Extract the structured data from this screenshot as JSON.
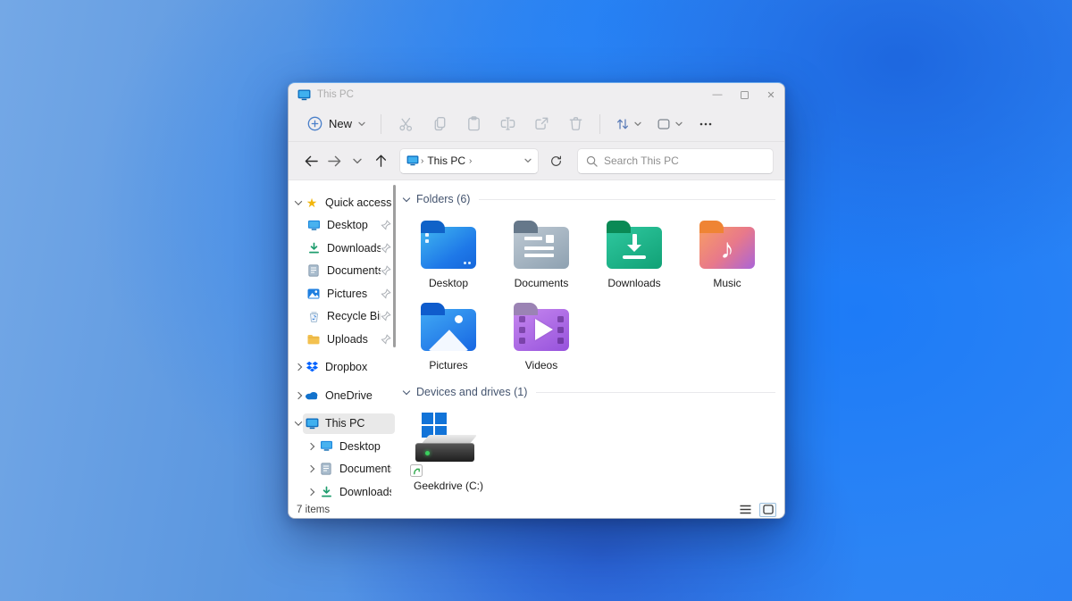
{
  "colors": {
    "accent": "#0067c0",
    "wallpaper_base": "#2e80f2",
    "selection_bg": "#e9e9e9",
    "section_header_text": "#44546f",
    "folder_desktop": "#1e78e8",
    "folder_documents": "#8ea1b1",
    "folder_downloads": "#11a176",
    "folder_music": "#e8798a",
    "folder_pictures": "#1766e2",
    "folder_videos": "#9652dc",
    "led_green": "#3ad05e"
  },
  "window": {
    "title": "This PC"
  },
  "toolbar": {
    "new_label": "New"
  },
  "navbar": {
    "breadcrumb_root": "This PC",
    "breadcrumb_sep1": "›",
    "breadcrumb_sep2": "›",
    "search_placeholder": "Search This PC"
  },
  "sidebar": {
    "quick_access": {
      "label": "Quick access",
      "items": [
        {
          "label": "Desktop"
        },
        {
          "label": "Downloads"
        },
        {
          "label": "Documents"
        },
        {
          "label": "Pictures"
        },
        {
          "label": "Recycle Bin"
        },
        {
          "label": "Uploads"
        }
      ]
    },
    "dropbox_label": "Dropbox",
    "onedrive_label": "OneDrive",
    "this_pc": {
      "label": "This PC",
      "items": [
        {
          "label": "Desktop"
        },
        {
          "label": "Documents"
        },
        {
          "label": "Downloads"
        }
      ]
    }
  },
  "main": {
    "folders": {
      "label": "Folders (6)",
      "items": [
        {
          "name": "Desktop"
        },
        {
          "name": "Documents"
        },
        {
          "name": "Downloads"
        },
        {
          "name": "Music"
        },
        {
          "name": "Pictures"
        },
        {
          "name": "Videos"
        }
      ]
    },
    "devices": {
      "label": "Devices and drives (1)",
      "drives": [
        {
          "name": "Geekdrive (C:)"
        }
      ]
    }
  },
  "statusbar": {
    "items_count": "7 items"
  }
}
